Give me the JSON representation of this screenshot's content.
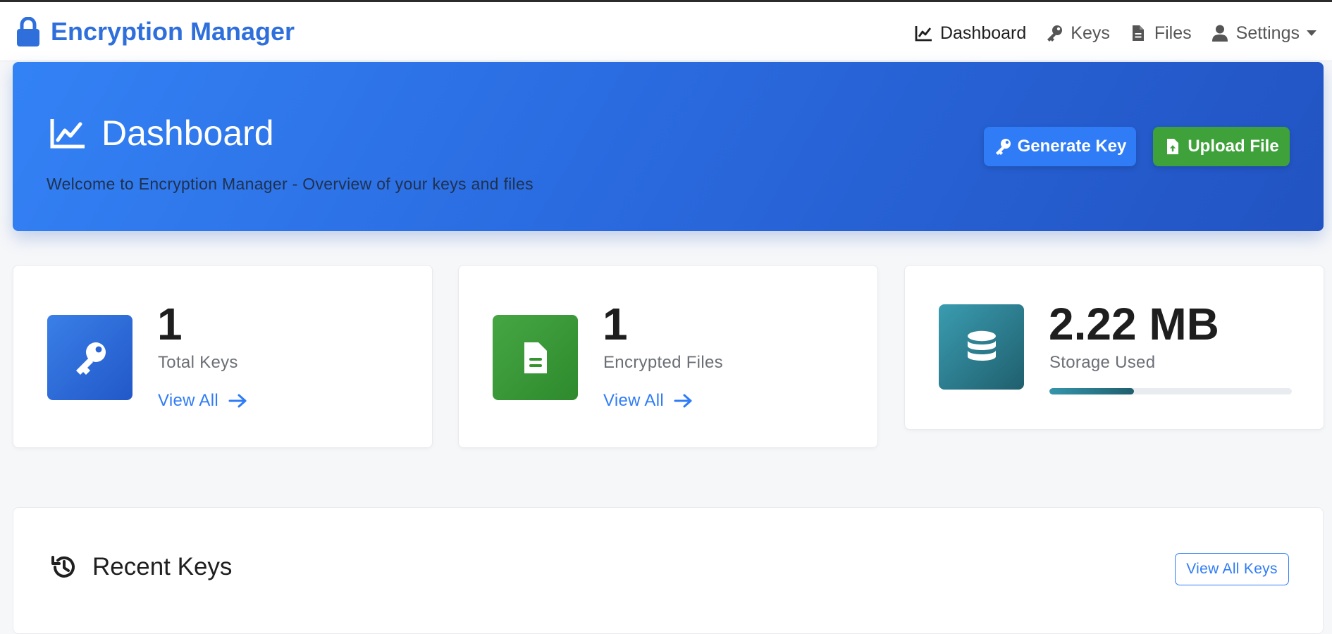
{
  "app": {
    "brand": "Encryption Manager",
    "accent_color": "#2f6fdc"
  },
  "nav": {
    "items": [
      {
        "label": "Dashboard",
        "icon": "chart-line-icon",
        "active": true
      },
      {
        "label": "Keys",
        "icon": "key-icon",
        "active": false
      },
      {
        "label": "Files",
        "icon": "file-icon",
        "active": false
      },
      {
        "label": "Settings",
        "icon": "user-icon",
        "active": false,
        "dropdown": true
      }
    ]
  },
  "hero": {
    "title": "Dashboard",
    "subtitle": "Welcome to Encryption Manager - Overview of your keys and files",
    "generate_key_label": "Generate Key",
    "upload_file_label": "Upload File"
  },
  "stats": [
    {
      "value": "1",
      "label": "Total Keys",
      "link": "View All",
      "icon": "key-icon",
      "color": "#2f6fdc"
    },
    {
      "value": "1",
      "label": "Encrypted Files",
      "link": "View All",
      "icon": "file-icon",
      "color": "#3ea13a"
    },
    {
      "value": "2.22 MB",
      "label": "Storage Used",
      "icon": "database-icon",
      "color": "#2a7f92",
      "progress_percent": 35
    }
  ],
  "recent_keys": {
    "title": "Recent Keys",
    "view_all_label": "View All Keys"
  }
}
